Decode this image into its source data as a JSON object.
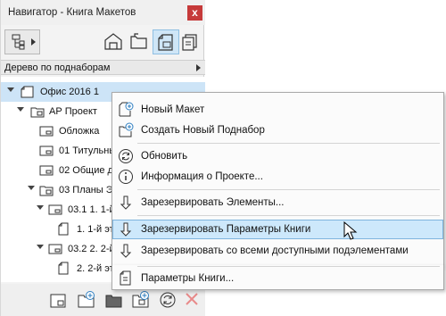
{
  "window": {
    "title": "Навигатор - Книга Макетов",
    "close": "x"
  },
  "view_dropdown": {
    "selected": "Дерево по поднаборам"
  },
  "tree": [
    {
      "label": "Офис 2016 1",
      "selected": true
    },
    {
      "label": "АР Проект"
    },
    {
      "label": "Обложка"
    },
    {
      "label": "01 Титульны"
    },
    {
      "label": "02 Общие д"
    },
    {
      "label": "03 Планы Э"
    },
    {
      "label": "03.1 1. 1-й"
    },
    {
      "label": "1. 1-й эт"
    },
    {
      "label": "03.2 2. 2-й"
    },
    {
      "label": "2. 2-й эт"
    }
  ],
  "context_menu": {
    "items": [
      {
        "label": "Новый Макет",
        "icon": "new-layout-icon"
      },
      {
        "label": "Создать Новый Поднабор",
        "icon": "new-subset-icon"
      },
      {
        "label": "Обновить",
        "icon": "refresh-icon"
      },
      {
        "label": "Информация о Проекте...",
        "icon": "info-icon"
      },
      {
        "label": "Зарезервировать Элементы...",
        "icon": "reserve-icon"
      },
      {
        "label": "Зарезервировать Параметры Книги",
        "icon": "reserve-icon",
        "highlighted": true
      },
      {
        "label": "Зарезервировать со всеми доступными подэлементами",
        "icon": "reserve-icon"
      },
      {
        "label": "Параметры Книги...",
        "icon": "book-settings-icon"
      }
    ]
  },
  "colors": {
    "selection": "#cde4f7",
    "menu_highlight": "#cde8fb",
    "close": "#c63a3a",
    "accent_icon": "#2f7fc1"
  }
}
